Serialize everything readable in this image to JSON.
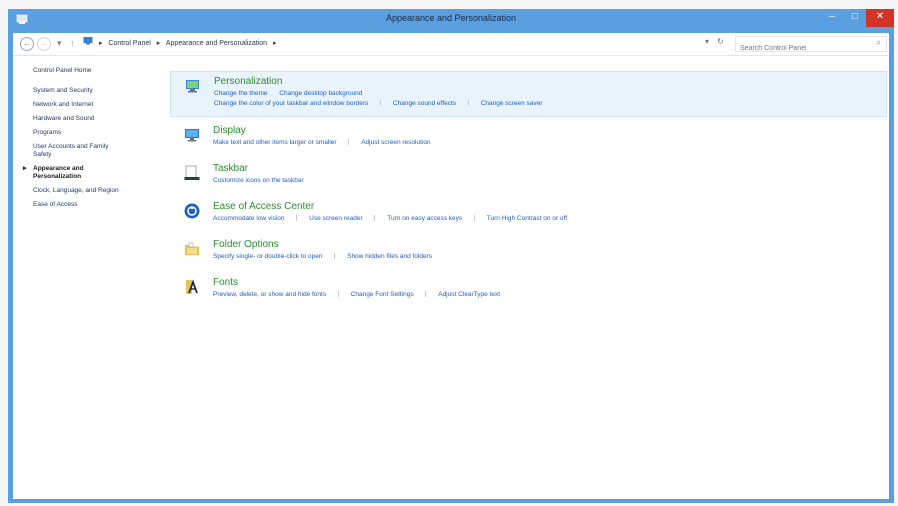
{
  "window": {
    "title": "Appearance and Personalization",
    "controls": {
      "minimize": "–",
      "maximize": "□",
      "close": "✕"
    }
  },
  "addressbar": {
    "back": "←",
    "forward": "→",
    "recent": "▾",
    "up": "↑",
    "path": [
      "Control Panel",
      "Appearance and Personalization"
    ],
    "separator": "▸",
    "dropdown": "▾",
    "refresh": "↻",
    "search_placeholder": "Search Control Panel",
    "search_icon": "⌕"
  },
  "sidebar": {
    "items": [
      {
        "label": "Control Panel Home"
      },
      {
        "label": "System and Security"
      },
      {
        "label": "Network and Internet"
      },
      {
        "label": "Hardware and Sound"
      },
      {
        "label": "Programs"
      },
      {
        "label": "User Accounts and Family Safety"
      },
      {
        "label": "Appearance and Personalization",
        "current": true
      },
      {
        "label": "Clock, Language, and Region"
      },
      {
        "label": "Ease of Access"
      }
    ]
  },
  "categories": [
    {
      "title": "Personalization",
      "icon": "personalization-icon",
      "links_row1": [
        "Change the theme",
        "Change desktop background"
      ],
      "links_row2": [
        "Change the color of your taskbar and window borders",
        "Change sound effects",
        "Change screen saver"
      ]
    },
    {
      "title": "Display",
      "icon": "display-icon",
      "links_row1": [
        "Make text and other items larger or smaller",
        "Adjust screen resolution"
      ]
    },
    {
      "title": "Taskbar",
      "icon": "taskbar-icon",
      "links_row1": [
        "Customize icons on the taskbar"
      ]
    },
    {
      "title": "Ease of Access Center",
      "icon": "ease-of-access-icon",
      "links_row1": [
        "Accommodate low vision",
        "Use screen reader",
        "Turn on easy access keys",
        "Turn High Contrast on or off"
      ]
    },
    {
      "title": "Folder Options",
      "icon": "folder-options-icon",
      "links_row1": [
        "Specify single- or double-click to open",
        "Show hidden files and folders"
      ]
    },
    {
      "title": "Fonts",
      "icon": "fonts-icon",
      "links_row1": [
        "Preview, delete, or show and hide fonts",
        "Change Font Settings",
        "Adjust ClearType text"
      ]
    }
  ],
  "colors": {
    "titlebar": "#5a9fe0",
    "close": "#d2342a",
    "link": "#1f5fbf",
    "category_title": "#2b8e2e",
    "highlight": "#e8f3fc"
  }
}
